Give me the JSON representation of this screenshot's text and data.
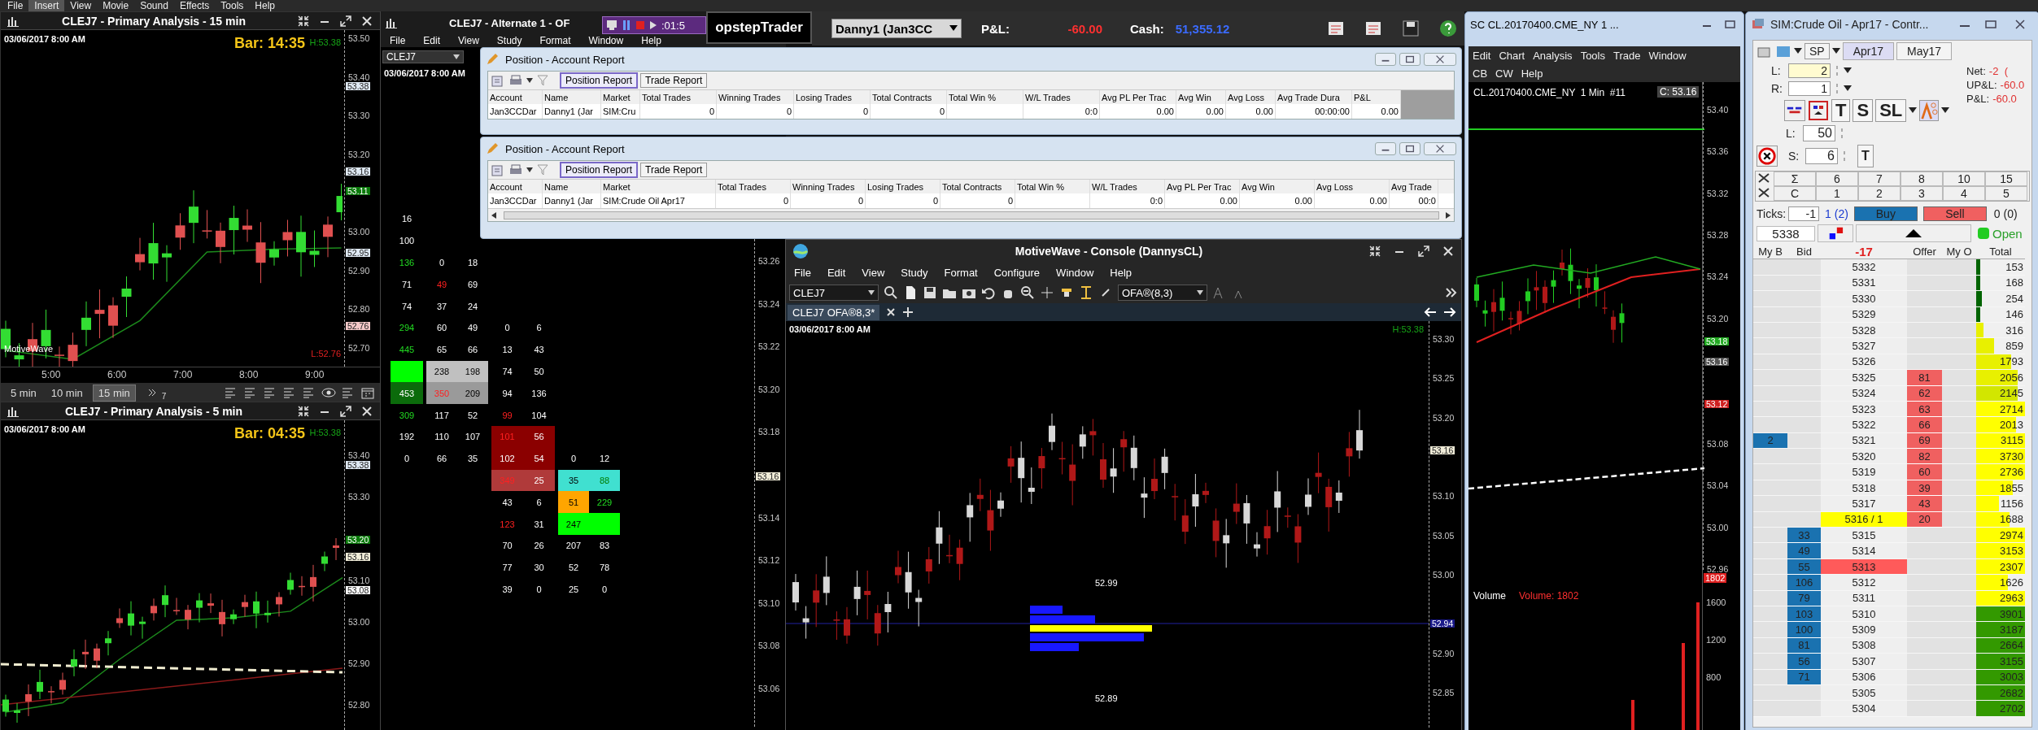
{
  "app_menu": [
    {
      "label": "File",
      "selected": false
    },
    {
      "label": "Insert",
      "selected": true
    },
    {
      "label": "View",
      "selected": false
    },
    {
      "label": "Movie",
      "selected": false
    },
    {
      "label": "Sound",
      "selected": false
    },
    {
      "label": "Effects",
      "selected": false
    },
    {
      "label": "Tools",
      "selected": false
    },
    {
      "label": "Help",
      "selected": false
    }
  ],
  "chart_15min": {
    "title": "CLEJ7 - Primary Analysis - 15 min",
    "date": "03/06/2017 8:00 AM",
    "bar_timer": "Bar: 14:35",
    "high": "H:53.38",
    "low": "L:52.76",
    "brand": "MotiveWave",
    "axis_labels": [
      "53.50",
      "53.40",
      "53.30",
      "53.20",
      "53.00",
      "52.90",
      "52.80",
      "52.70"
    ],
    "price_tags": [
      {
        "label": "53.38",
        "color": "#dfe9f3"
      },
      {
        "label": "53.16",
        "color": "#dfe9f3"
      },
      {
        "label": "53.11",
        "color": "#0b7a0b"
      },
      {
        "label": "52.95",
        "color": "#dfe9f3"
      },
      {
        "label": "52.76",
        "color": "#f4c8c8"
      }
    ],
    "time_labels": [
      "5:00",
      "6:00",
      "7:00",
      "8:00",
      "9:00"
    ],
    "timeframes": [
      {
        "label": "5 min",
        "selected": false
      },
      {
        "label": "10 min",
        "selected": false
      },
      {
        "label": "15 min",
        "selected": true
      }
    ],
    "overflow_count": "7"
  },
  "chart_5min": {
    "title": "CLEJ7 - Primary Analysis - 5 min",
    "date": "03/06/2017 8:00 AM",
    "bar_timer": "Bar: 04:35",
    "high": "H:53.38",
    "axis_labels": [
      "53.40",
      "53.30",
      "53.10",
      "53.00",
      "52.90",
      "52.80"
    ],
    "price_tags": [
      {
        "label": "53.38",
        "color": "#dfe9f3"
      },
      {
        "label": "53.20",
        "color": "#0b7a0b"
      },
      {
        "label": "53.16",
        "color": "#f0ecd8"
      },
      {
        "label": "53.08",
        "color": "#ffffff"
      }
    ]
  },
  "footprint": {
    "title": "CLEJ7 - Alternate 1 - OF",
    "menu": [
      "File",
      "Edit",
      "View",
      "Study",
      "Format",
      "Window",
      "Help"
    ],
    "symbol": "CLEJ7",
    "date": "03/06/2017 8:00 AM",
    "axis_labels": [
      "53.26",
      "53.24",
      "53.22",
      "53.20",
      "53.18",
      "53.14",
      "53.12",
      "53.10",
      "53.08",
      "53.06"
    ],
    "price_tags": [
      {
        "label": "53.16",
        "color": "#f0ecd8"
      }
    ],
    "rows": [
      {
        "a": {
          "text": "16",
          "kind": "plain"
        }
      },
      {
        "a": {
          "text": "100",
          "kind": "plain"
        }
      },
      {
        "a": {
          "text": "136",
          "kind": "up"
        },
        "b": [
          {
            "text": "0",
            "kind": "plain"
          },
          {
            "text": "18",
            "kind": "plain"
          }
        ]
      },
      {
        "a": {
          "text": "71",
          "kind": "plain"
        },
        "b": [
          {
            "text": "49",
            "kind": "down"
          },
          {
            "text": "69",
            "kind": "plain"
          }
        ]
      },
      {
        "a": {
          "text": "74",
          "kind": "plain"
        },
        "b": [
          {
            "text": "37",
            "kind": "plain"
          },
          {
            "text": "24",
            "kind": "plain"
          }
        ]
      },
      {
        "a": {
          "text": "294",
          "kind": "up"
        },
        "b": [
          {
            "text": "60",
            "kind": "plain"
          },
          {
            "text": "49",
            "kind": "plain"
          }
        ],
        "c": [
          {
            "text": "0",
            "kind": "plain"
          },
          {
            "text": "6",
            "kind": "plain"
          }
        ]
      },
      {
        "a": {
          "text": "445",
          "kind": "up"
        },
        "b": [
          {
            "text": "65",
            "kind": "plain"
          },
          {
            "text": "66",
            "kind": "plain"
          }
        ],
        "c": [
          {
            "text": "13",
            "kind": "plain"
          },
          {
            "text": "43",
            "kind": "plain"
          }
        ]
      },
      {
        "a": {
          "kind": "block",
          "color": "#00ff00"
        },
        "b": [
          {
            "text": "238",
            "kind": "plain",
            "color": "#c0c0c0"
          },
          {
            "text": "198",
            "kind": "plain",
            "color": "#c0c0c0"
          }
        ],
        "c": [
          {
            "text": "74",
            "kind": "plain"
          },
          {
            "text": "50",
            "kind": "plain"
          }
        ]
      },
      {
        "a": {
          "text": "453",
          "kind": "plain",
          "color": "#0b6b0b"
        },
        "b": [
          {
            "text": "350",
            "kind": "down",
            "color": "#9a9a9a"
          },
          {
            "text": "209",
            "kind": "plain",
            "color": "#9a9a9a"
          }
        ],
        "c": [
          {
            "text": "94",
            "kind": "plain"
          },
          {
            "text": "136",
            "kind": "plain"
          }
        ]
      },
      {
        "a": {
          "text": "309",
          "kind": "up"
        },
        "b": [
          {
            "text": "117",
            "kind": "plain"
          },
          {
            "text": "52",
            "kind": "plain"
          }
        ],
        "c": [
          {
            "text": "99",
            "kind": "down"
          },
          {
            "text": "104",
            "kind": "plain"
          }
        ]
      },
      {
        "a": {
          "text": "192",
          "kind": "plain"
        },
        "b": [
          {
            "text": "110",
            "kind": "plain"
          },
          {
            "text": "107",
            "kind": "plain"
          }
        ],
        "c": [
          {
            "text": "101",
            "kind": "down",
            "color": "#8b0000"
          },
          {
            "text": "56",
            "kind": "plain",
            "color": "#8b0000"
          }
        ]
      },
      {
        "a": {
          "text": "0",
          "kind": "plain"
        },
        "b": [
          {
            "text": "66",
            "kind": "plain"
          },
          {
            "text": "35",
            "kind": "plain"
          }
        ],
        "c": [
          {
            "text": "102",
            "kind": "plain",
            "color": "#8b0000"
          },
          {
            "text": "54",
            "kind": "plain",
            "color": "#8b0000"
          }
        ],
        "d": [
          {
            "text": "0",
            "kind": "plain"
          },
          {
            "text": "12",
            "kind": "plain"
          }
        ]
      },
      {
        "c": [
          {
            "text": "349",
            "kind": "down",
            "color": "#b03a3a"
          },
          {
            "text": "25",
            "kind": "plain",
            "color": "#b03a3a"
          }
        ],
        "d": [
          {
            "text": "35",
            "kind": "plain",
            "color": "#40e0d0"
          },
          {
            "text": "88",
            "kind": "up",
            "color": "#40e0d0"
          }
        ]
      },
      {
        "c": [
          {
            "text": "43",
            "kind": "plain"
          },
          {
            "text": "6",
            "kind": "plain"
          }
        ],
        "d": [
          {
            "text": "51",
            "kind": "plain",
            "color": "#ffa500"
          },
          {
            "text": "229",
            "kind": "up"
          }
        ]
      },
      {
        "c": [
          {
            "text": "123",
            "kind": "down"
          },
          {
            "text": "31",
            "kind": "plain"
          }
        ],
        "d": [
          {
            "text": "247",
            "kind": "plain",
            "color": "#00ff00"
          },
          {
            "kind": "block",
            "color": "#00ff00"
          }
        ]
      },
      {
        "c": [
          {
            "text": "70",
            "kind": "plain"
          },
          {
            "text": "26",
            "kind": "plain"
          }
        ],
        "d": [
          {
            "text": "207",
            "kind": "plain"
          },
          {
            "text": "83",
            "kind": "plain"
          }
        ]
      },
      {
        "c": [
          {
            "text": "77",
            "kind": "plain"
          },
          {
            "text": "30",
            "kind": "plain"
          }
        ],
        "d": [
          {
            "text": "52",
            "kind": "plain"
          },
          {
            "text": "78",
            "kind": "plain"
          }
        ]
      },
      {
        "c": [
          {
            "text": "39",
            "kind": "plain"
          },
          {
            "text": "0",
            "kind": "plain"
          }
        ],
        "d": [
          {
            "text": "25",
            "kind": "plain"
          },
          {
            "text": "0",
            "kind": "plain"
          }
        ]
      }
    ]
  },
  "recorder": {
    "timer": ":01:5"
  },
  "brand": "opstepTrader",
  "account_bar": {
    "account": "Danny1 (Jan3CC",
    "pnl_label": "P&L:",
    "pnl": "-60.00",
    "cash_label": "Cash:",
    "cash": "51,355.12"
  },
  "reports": [
    {
      "title": "Position - Account Report",
      "tabs": [
        {
          "label": "Position Report",
          "selected": true
        },
        {
          "label": "Trade Report",
          "selected": false
        }
      ],
      "columns": [
        "Account",
        "Name",
        "Market",
        "Total Trades",
        "Winning Trades",
        "Losing Trades",
        "Total Contracts",
        "Total Win %",
        "W/L Trades",
        "Avg PL Per Trac",
        "Avg Win",
        "Avg Loss",
        "Avg Trade Dura",
        "P&L"
      ],
      "row": [
        {
          "kind": "text",
          "text": "Jan3CCDar"
        },
        {
          "kind": "text",
          "text": "Danny1 (Jar"
        },
        {
          "kind": "text",
          "text": "SIM:Cru"
        },
        {
          "kind": "text",
          "text": "0"
        },
        {
          "kind": "text",
          "text": "0"
        },
        {
          "kind": "text",
          "text": "0"
        },
        {
          "kind": "text",
          "text": "0"
        },
        {
          "kind": "blank"
        },
        {
          "kind": "text",
          "text": "0:0"
        },
        {
          "kind": "text",
          "text": "0.00"
        },
        {
          "kind": "text",
          "text": "0.00"
        },
        {
          "kind": "text",
          "text": "0.00"
        },
        {
          "kind": "text",
          "text": "00:00:00"
        },
        {
          "kind": "text",
          "text": "0.00"
        }
      ]
    },
    {
      "title": "Position - Account Report",
      "tabs": [
        {
          "label": "Position Report",
          "selected": true
        },
        {
          "label": "Trade Report",
          "selected": false
        }
      ],
      "columns": [
        "Account",
        "Name",
        "Market",
        "Total Trades",
        "Winning Trades",
        "Losing Trades",
        "Total Contracts",
        "Total Win %",
        "W/L Trades",
        "Avg PL Per Trac",
        "Avg Win",
        "Avg Loss",
        "Avg Trade"
      ],
      "row": [
        {
          "kind": "text",
          "text": "Jan3CCDar"
        },
        {
          "kind": "text",
          "text": "Danny1 (Jar"
        },
        {
          "kind": "text",
          "text": "SIM:Crude Oil Apr17"
        },
        {
          "kind": "text",
          "text": "0"
        },
        {
          "kind": "text",
          "text": "0"
        },
        {
          "kind": "text",
          "text": "0"
        },
        {
          "kind": "text",
          "text": "0"
        },
        {
          "kind": "blank"
        },
        {
          "kind": "text",
          "text": "0:0"
        },
        {
          "kind": "text",
          "text": "0.00"
        },
        {
          "kind": "text",
          "text": "0.00"
        },
        {
          "kind": "text",
          "text": "0.00"
        },
        {
          "kind": "text",
          "text": "00:0"
        }
      ]
    }
  ],
  "console": {
    "title": "MotiveWave - Console (DannysCL)",
    "menu": [
      "File",
      "Edit",
      "View",
      "Study",
      "Format",
      "Configure",
      "Window",
      "Help"
    ],
    "symbol": "CLEJ7",
    "study": "OFA®(8,3)",
    "tabs": [
      {
        "label": "CLEJ7 OFA®8,3*",
        "selected": true
      }
    ],
    "date": "03/06/2017 8:00 AM",
    "high": "H:53.38",
    "axis_labels": [
      "53.30",
      "53.25",
      "53.20",
      "53.10",
      "53.05",
      "53.00",
      "52.90",
      "52.85"
    ],
    "price_tags": [
      {
        "label": "53.16",
        "color": "#f0ecd8"
      },
      {
        "label": "52.94",
        "color": "#1a1a8a"
      }
    ],
    "chart_labels": [
      "52.99",
      "52.89"
    ]
  },
  "sc_window": {
    "title": "SC CL.20170400.CME_NY  1 ...",
    "menu": [
      "Edit",
      "Chart",
      "Analysis",
      "Tools",
      "Trade",
      "Window"
    ],
    "menu2": [
      "CB",
      "CW",
      "Help"
    ],
    "heading": "CL.20170400.CME_NY  1 Min  #11",
    "close_reading": "C: 53.16",
    "axis_labels": [
      "53.40",
      "53.36",
      "53.32",
      "53.28",
      "53.24",
      "53.20",
      "53.08",
      "53.04",
      "53.00",
      "52.96"
    ],
    "price_tags": [
      {
        "label": "53.18",
        "color": "#22aa22"
      },
      {
        "label": "53.16",
        "color": "#555555"
      },
      {
        "label": "53.12",
        "color": "#d02020"
      }
    ],
    "volume_label": "Volume",
    "volume_reading": "Volume: 1802",
    "volume_axis": [
      "1600",
      "1200",
      "800"
    ],
    "volume_tag": "1802"
  },
  "dom": {
    "title": "SIM:Crude Oil - Apr17 - Contr...",
    "exchange": "SP",
    "contracts": [
      {
        "label": "Apr17",
        "selected": true
      },
      {
        "label": "May17",
        "selected": false
      }
    ],
    "quantities": [
      {
        "label": "L:",
        "value": "2",
        "focused": true
      },
      {
        "label": "R:",
        "value": "1",
        "focused": false
      }
    ],
    "stats": [
      {
        "label": "Net:",
        "value": "-2  ("
      },
      {
        "label": "UP&L:",
        "value": "-60.0"
      },
      {
        "label": "P&L:",
        "value": "-60.0"
      }
    ],
    "order_buttons": [
      "T",
      "S",
      "SL"
    ],
    "brackets": [
      {
        "label": "L:",
        "value": "50"
      },
      {
        "label": "S:",
        "value": "6"
      }
    ],
    "stop_button": "T",
    "qty_grid": [
      [
        "Σ",
        "6",
        "7",
        "8",
        "10",
        "15"
      ],
      [
        "C",
        "1",
        "2",
        "3",
        "4",
        "5"
      ]
    ],
    "ticks_label": "Ticks:",
    "ticks": "-1",
    "buy_count": "1 (2)",
    "buy": "Buy",
    "sell": "Sell",
    "sell_count": "0 (0)",
    "price_field": "5338",
    "status": "Open",
    "connected": true,
    "headers": [
      "My B",
      "Bid",
      "-17",
      "Offer",
      "My O",
      "Total"
    ],
    "ladder": [
      {
        "price": "5332",
        "total": "153",
        "level": 0.08,
        "color": "#006400"
      },
      {
        "price": "5331",
        "total": "168",
        "level": 0.08,
        "color": "#006400"
      },
      {
        "price": "5330",
        "total": "254",
        "level": 0.12,
        "color": "#006400"
      },
      {
        "price": "5329",
        "total": "146",
        "level": 0.08,
        "color": "#006400"
      },
      {
        "price": "5328",
        "total": "316",
        "level": 0.15,
        "color": "#e8f000"
      },
      {
        "price": "5327",
        "total": "859",
        "level": 0.36,
        "color": "#e8f000"
      },
      {
        "price": "5326",
        "total": "1793",
        "level": 0.72,
        "color": "#e8f000"
      },
      {
        "price": "5325",
        "offer": "81",
        "total": "2056",
        "level": 0.85,
        "color": "#e8f000"
      },
      {
        "price": "5324",
        "offer": "62",
        "total": "2145",
        "level": 0.85,
        "color": "#d2e600"
      },
      {
        "price": "5323",
        "offer": "63",
        "total": "2714",
        "level": 1,
        "color": "#ffff00"
      },
      {
        "price": "5322",
        "offer": "66",
        "total": "2013",
        "level": 0.82,
        "color": "#ffff00"
      },
      {
        "price": "5321",
        "my_bid": "2",
        "offer": "69",
        "total": "3115",
        "level": 1,
        "color": "#ffff00"
      },
      {
        "price": "5320",
        "offer": "82",
        "total": "3730",
        "level": 1,
        "color": "#ffff00"
      },
      {
        "price": "5319",
        "offer": "60",
        "total": "2736",
        "level": 1,
        "color": "#ffff00"
      },
      {
        "price": "5318",
        "offer": "39",
        "total": "1855",
        "level": 0.75,
        "color": "#ffff00"
      },
      {
        "price": "5317",
        "offer": "43",
        "total": "1156",
        "level": 0.47,
        "color": "#ffff00"
      },
      {
        "price": "5316 / 1",
        "price_mark": {
          "color": "#ffff00"
        },
        "offer": "20",
        "total": "1688",
        "level": 0.68,
        "color": "#ffff00"
      },
      {
        "price": "5315",
        "bid": "33",
        "total": "2974",
        "level": 1,
        "color": "#ffff00"
      },
      {
        "price": "5314",
        "bid": "49",
        "total": "3153",
        "level": 1,
        "color": "#ffff00"
      },
      {
        "price": "5313",
        "price_mark": {
          "color": "#ff5a5a"
        },
        "bid": "55",
        "total": "2307",
        "level": 1,
        "color": "#ffff00"
      },
      {
        "price": "5312",
        "bid": "106",
        "total": "1626",
        "level": 0.65,
        "color": "#ffff00"
      },
      {
        "price": "5311",
        "bid": "79",
        "total": "2963",
        "level": 1,
        "color": "#ffff00"
      },
      {
        "price": "5310",
        "bid": "103",
        "total": "3901",
        "level": 1,
        "color": "#339900"
      },
      {
        "price": "5309",
        "bid": "100",
        "total": "3187",
        "level": 1,
        "color": "#339900"
      },
      {
        "price": "5308",
        "bid": "81",
        "total": "2664",
        "level": 1,
        "color": "#339900"
      },
      {
        "price": "5307",
        "bid": "56",
        "total": "3155",
        "level": 1,
        "color": "#339900"
      },
      {
        "price": "5306",
        "bid": "71",
        "total": "3003",
        "level": 1,
        "color": "#339900"
      },
      {
        "price": "5305",
        "total": "2682",
        "level": 1,
        "color": "#339900"
      },
      {
        "price": "5304",
        "total": "2702",
        "level": 1,
        "color": "#339900"
      }
    ]
  }
}
